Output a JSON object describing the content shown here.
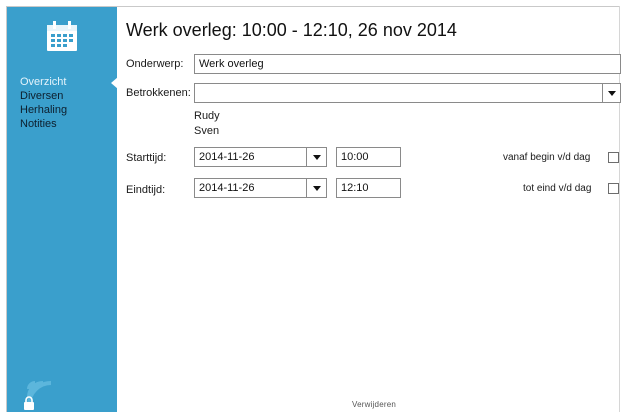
{
  "sidebar": {
    "calendar_icon": "calendar-icon",
    "items": [
      {
        "label": "Overzicht",
        "active": true
      },
      {
        "label": "Diversen",
        "active": false
      },
      {
        "label": "Herhaling",
        "active": false
      },
      {
        "label": "Notities",
        "active": false
      }
    ],
    "status_icons": [
      "wifi-icon",
      "lock-icon"
    ],
    "color": "#3a9fcc"
  },
  "header": {
    "title": "Werk overleg: 10:00 - 12:10, 26 nov 2014"
  },
  "form": {
    "subject_label": "Onderwerp:",
    "subject_value": "Werk overleg",
    "participants_label": "Betrokkenen:",
    "participants_value": "",
    "participants": [
      "Rudy",
      "Sven"
    ],
    "start_label": "Starttijd:",
    "start_date": "2014-11-26",
    "start_time": "10:00",
    "start_allday_label": "vanaf begin v/d dag",
    "start_allday_checked": false,
    "end_label": "Eindtijd:",
    "end_date": "2014-11-26",
    "end_time": "12:10",
    "end_allday_label": "tot eind v/d dag",
    "end_allday_checked": false
  },
  "footer": {
    "delete_label": "Verwijderen"
  }
}
